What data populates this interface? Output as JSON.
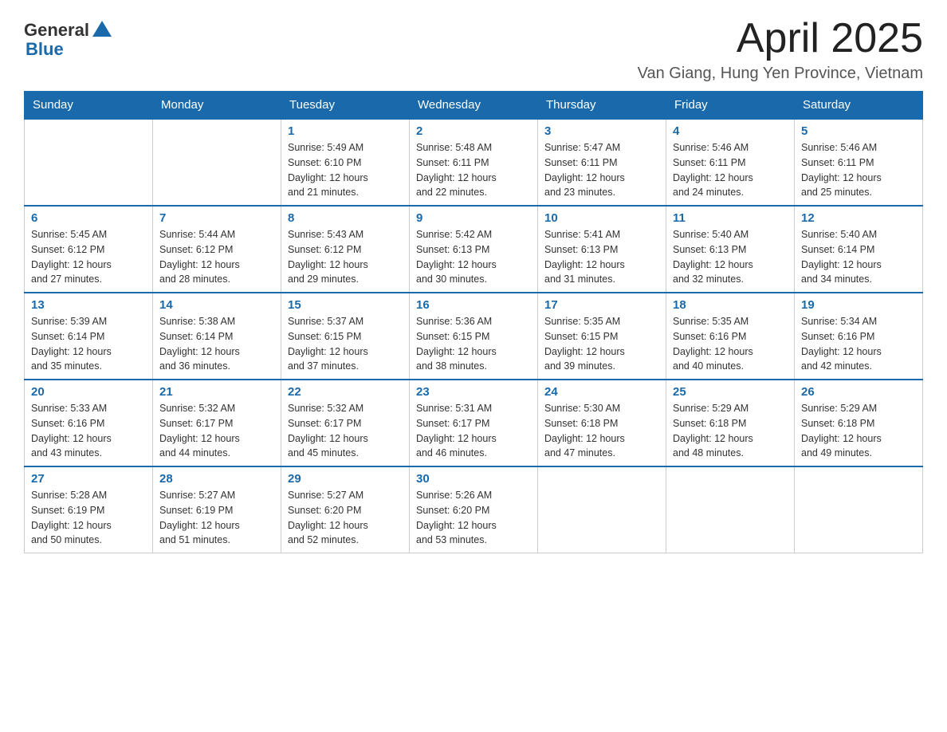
{
  "header": {
    "logo_general": "General",
    "logo_blue": "Blue",
    "month_title": "April 2025",
    "location": "Van Giang, Hung Yen Province, Vietnam"
  },
  "days_of_week": [
    "Sunday",
    "Monday",
    "Tuesday",
    "Wednesday",
    "Thursday",
    "Friday",
    "Saturday"
  ],
  "weeks": [
    [
      {
        "day": "",
        "info": ""
      },
      {
        "day": "",
        "info": ""
      },
      {
        "day": "1",
        "info": "Sunrise: 5:49 AM\nSunset: 6:10 PM\nDaylight: 12 hours\nand 21 minutes."
      },
      {
        "day": "2",
        "info": "Sunrise: 5:48 AM\nSunset: 6:11 PM\nDaylight: 12 hours\nand 22 minutes."
      },
      {
        "day": "3",
        "info": "Sunrise: 5:47 AM\nSunset: 6:11 PM\nDaylight: 12 hours\nand 23 minutes."
      },
      {
        "day": "4",
        "info": "Sunrise: 5:46 AM\nSunset: 6:11 PM\nDaylight: 12 hours\nand 24 minutes."
      },
      {
        "day": "5",
        "info": "Sunrise: 5:46 AM\nSunset: 6:11 PM\nDaylight: 12 hours\nand 25 minutes."
      }
    ],
    [
      {
        "day": "6",
        "info": "Sunrise: 5:45 AM\nSunset: 6:12 PM\nDaylight: 12 hours\nand 27 minutes."
      },
      {
        "day": "7",
        "info": "Sunrise: 5:44 AM\nSunset: 6:12 PM\nDaylight: 12 hours\nand 28 minutes."
      },
      {
        "day": "8",
        "info": "Sunrise: 5:43 AM\nSunset: 6:12 PM\nDaylight: 12 hours\nand 29 minutes."
      },
      {
        "day": "9",
        "info": "Sunrise: 5:42 AM\nSunset: 6:13 PM\nDaylight: 12 hours\nand 30 minutes."
      },
      {
        "day": "10",
        "info": "Sunrise: 5:41 AM\nSunset: 6:13 PM\nDaylight: 12 hours\nand 31 minutes."
      },
      {
        "day": "11",
        "info": "Sunrise: 5:40 AM\nSunset: 6:13 PM\nDaylight: 12 hours\nand 32 minutes."
      },
      {
        "day": "12",
        "info": "Sunrise: 5:40 AM\nSunset: 6:14 PM\nDaylight: 12 hours\nand 34 minutes."
      }
    ],
    [
      {
        "day": "13",
        "info": "Sunrise: 5:39 AM\nSunset: 6:14 PM\nDaylight: 12 hours\nand 35 minutes."
      },
      {
        "day": "14",
        "info": "Sunrise: 5:38 AM\nSunset: 6:14 PM\nDaylight: 12 hours\nand 36 minutes."
      },
      {
        "day": "15",
        "info": "Sunrise: 5:37 AM\nSunset: 6:15 PM\nDaylight: 12 hours\nand 37 minutes."
      },
      {
        "day": "16",
        "info": "Sunrise: 5:36 AM\nSunset: 6:15 PM\nDaylight: 12 hours\nand 38 minutes."
      },
      {
        "day": "17",
        "info": "Sunrise: 5:35 AM\nSunset: 6:15 PM\nDaylight: 12 hours\nand 39 minutes."
      },
      {
        "day": "18",
        "info": "Sunrise: 5:35 AM\nSunset: 6:16 PM\nDaylight: 12 hours\nand 40 minutes."
      },
      {
        "day": "19",
        "info": "Sunrise: 5:34 AM\nSunset: 6:16 PM\nDaylight: 12 hours\nand 42 minutes."
      }
    ],
    [
      {
        "day": "20",
        "info": "Sunrise: 5:33 AM\nSunset: 6:16 PM\nDaylight: 12 hours\nand 43 minutes."
      },
      {
        "day": "21",
        "info": "Sunrise: 5:32 AM\nSunset: 6:17 PM\nDaylight: 12 hours\nand 44 minutes."
      },
      {
        "day": "22",
        "info": "Sunrise: 5:32 AM\nSunset: 6:17 PM\nDaylight: 12 hours\nand 45 minutes."
      },
      {
        "day": "23",
        "info": "Sunrise: 5:31 AM\nSunset: 6:17 PM\nDaylight: 12 hours\nand 46 minutes."
      },
      {
        "day": "24",
        "info": "Sunrise: 5:30 AM\nSunset: 6:18 PM\nDaylight: 12 hours\nand 47 minutes."
      },
      {
        "day": "25",
        "info": "Sunrise: 5:29 AM\nSunset: 6:18 PM\nDaylight: 12 hours\nand 48 minutes."
      },
      {
        "day": "26",
        "info": "Sunrise: 5:29 AM\nSunset: 6:18 PM\nDaylight: 12 hours\nand 49 minutes."
      }
    ],
    [
      {
        "day": "27",
        "info": "Sunrise: 5:28 AM\nSunset: 6:19 PM\nDaylight: 12 hours\nand 50 minutes."
      },
      {
        "day": "28",
        "info": "Sunrise: 5:27 AM\nSunset: 6:19 PM\nDaylight: 12 hours\nand 51 minutes."
      },
      {
        "day": "29",
        "info": "Sunrise: 5:27 AM\nSunset: 6:20 PM\nDaylight: 12 hours\nand 52 minutes."
      },
      {
        "day": "30",
        "info": "Sunrise: 5:26 AM\nSunset: 6:20 PM\nDaylight: 12 hours\nand 53 minutes."
      },
      {
        "day": "",
        "info": ""
      },
      {
        "day": "",
        "info": ""
      },
      {
        "day": "",
        "info": ""
      }
    ]
  ]
}
